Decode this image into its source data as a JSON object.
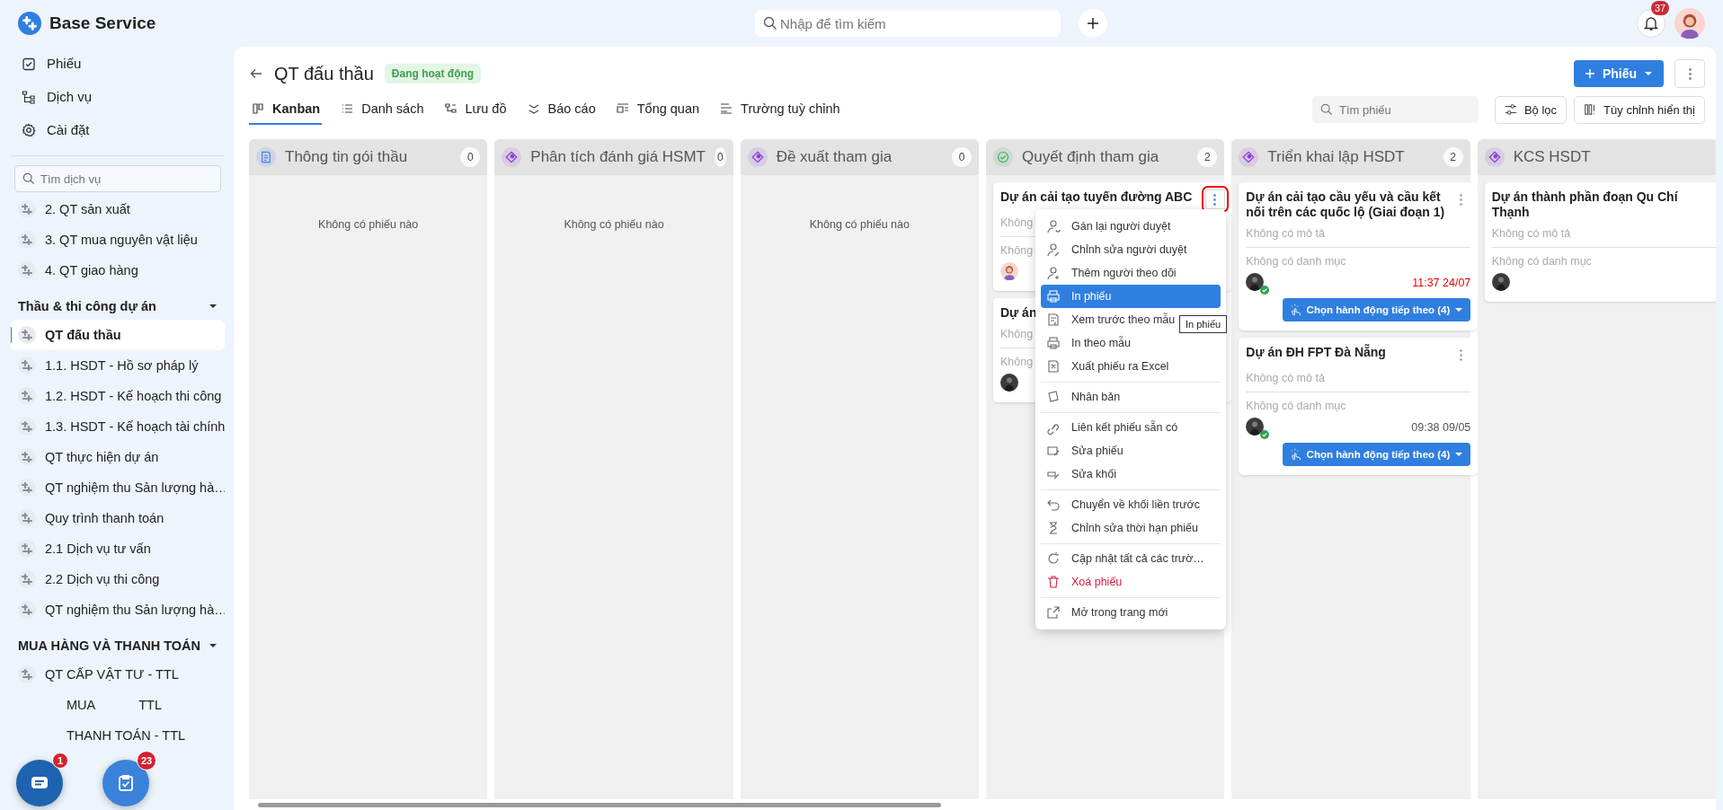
{
  "app": {
    "name": "Base Service"
  },
  "topbar": {
    "search_placeholder": "Nhập để tìm kiếm",
    "notification_badge": "37"
  },
  "sidebar": {
    "nav": [
      {
        "label": "Phiếu"
      },
      {
        "label": "Dịch vụ"
      },
      {
        "label": "Cài đặt"
      }
    ],
    "search_placeholder": "Tìm dịch vụ",
    "items": [
      {
        "label": "2. QT sản xuất",
        "selected": false
      },
      {
        "label": "3. QT mua nguyên vật liệu",
        "selected": false
      },
      {
        "label": "4. QT giao hàng",
        "selected": false
      }
    ],
    "groups": [
      {
        "title": "Thầu & thi công dự án",
        "expanded": true,
        "items": [
          {
            "label": "QT đấu thầu",
            "selected": true
          },
          {
            "label": "1.1. HSDT - Hồ sơ pháp lý",
            "selected": false
          },
          {
            "label": "1.2. HSDT - Kế hoạch thi công",
            "selected": false
          },
          {
            "label": "1.3. HSDT - Kế hoạch tài chính",
            "selected": false
          },
          {
            "label": "QT thực hiện dự án",
            "selected": false
          },
          {
            "label": "QT nghiệm thu Sản lượng hà…",
            "selected": false
          },
          {
            "label": "Quy trình thanh toán",
            "selected": false
          },
          {
            "label": "2.1 Dịch vụ tư vấn",
            "selected": false
          },
          {
            "label": "2.2 Dịch vụ thi công",
            "selected": false
          },
          {
            "label": "QT nghiệm thu Sản lượng hà…",
            "selected": false
          }
        ]
      },
      {
        "title": "MUA HÀNG VÀ THANH TOÁN",
        "expanded": true,
        "items": [
          {
            "label": "QT CẤP VẬT TƯ - TTL",
            "selected": false
          },
          {
            "parts": [
              "MUA",
              "TTL"
            ],
            "selected": false
          },
          {
            "parts": [
              "THANH TOÁN - TTL"
            ],
            "selected": false
          }
        ]
      }
    ]
  },
  "floating_buttons": [
    {
      "kind": "chat",
      "badge": "1"
    },
    {
      "kind": "tasks",
      "badge": "23"
    }
  ],
  "page": {
    "title": "QT đấu thầu",
    "status": "Đang hoạt động",
    "new_button": "Phiếu"
  },
  "tabs": [
    {
      "label": "Kanban",
      "selected": true
    },
    {
      "label": "Danh sách",
      "selected": false
    },
    {
      "label": "Lưu đồ",
      "selected": false
    },
    {
      "label": "Báo cáo",
      "selected": false
    },
    {
      "label": "Tổng quan",
      "selected": false
    },
    {
      "label": "Trường tuỳ chỉnh",
      "selected": false
    }
  ],
  "toolbar": {
    "search_placeholder": "Tìm phiếu",
    "filter": "Bộ lọc",
    "customize": "Tùy chỉnh hiển thị"
  },
  "columns": [
    {
      "title": "Thông tin gói thầu",
      "count": "0",
      "kind": "doc",
      "color": "#4a80e8",
      "empty": "Không có phiếu nào"
    },
    {
      "title": "Phân tích đánh giá HSMT",
      "count": "0",
      "kind": "diamond",
      "color": "#8e3fd6",
      "empty": "Không có phiếu nào"
    },
    {
      "title": "Đề xuất tham gia",
      "count": "0",
      "kind": "diamond",
      "color": "#8e3fd6",
      "empty": "Không có phiếu nào"
    },
    {
      "title": "Quyết định tham gia",
      "count": "2",
      "kind": "check",
      "color": "#3fae5a",
      "cards": [
        {
          "title": "Dự án cải tạo tuyến đường ABC",
          "description": "Không",
          "category": "Không",
          "avatar": {
            "kind": "woman"
          },
          "approved": false,
          "menu_open": true
        },
        {
          "title": "Dự án",
          "description": "Không",
          "category": "Không",
          "avatar": {
            "kind": "dark"
          },
          "approved": false
        }
      ]
    },
    {
      "title": "Triển khai lập HSDT",
      "count": "2",
      "kind": "diamond",
      "color": "#8e3fd6",
      "cards": [
        {
          "title": "Dự án cải tạo cầu yếu và cầu kết nối trên các quốc lộ (Giai đoạn 1)",
          "description": "Không có mô tả",
          "category": "Không có danh mục",
          "avatar": {
            "kind": "dark"
          },
          "approved": true,
          "time": "11:37 24/07",
          "overdue": true,
          "action": "Chọn hành động tiếp theo (4)",
          "menu_open": false
        },
        {
          "title": "Dự án ĐH FPT Đà Nẵng",
          "description": "Không có mô tả",
          "category": "Không có danh mục",
          "avatar": {
            "kind": "dark"
          },
          "approved": true,
          "time": "09:38 09/05",
          "overdue": false,
          "action": "Chọn hành động tiếp theo (4)",
          "menu_open": false
        }
      ]
    },
    {
      "title": "KCS HSDT",
      "kind": "diamond",
      "color": "#8e3fd6",
      "cards": [
        {
          "title": "Dự án thành phần đoạn Qu Chí Thạnh",
          "description": "Không có mô tả",
          "category": "Không có danh mục",
          "avatar": {
            "kind": "dark"
          },
          "approved": false
        }
      ]
    }
  ],
  "context_menu": {
    "tooltip": "In phiếu",
    "items": [
      {
        "label": "Gán lại người duyệt",
        "selected": false
      },
      {
        "label": "Chỉnh sửa người duyệt",
        "selected": false
      },
      {
        "label": "Thêm người theo dõi",
        "selected": false
      },
      {
        "label": "In phiếu",
        "selected": true
      },
      {
        "label": "Xem trước theo mẫu",
        "selected": false
      },
      {
        "label": "In theo mẫu",
        "selected": false
      },
      {
        "label": "Xuất phiếu ra Excel",
        "selected": false
      },
      {
        "label": "Nhân bản",
        "selected": false,
        "divider_before": true
      },
      {
        "label": "Liên kết phiếu sẵn có",
        "selected": false,
        "divider_before": true
      },
      {
        "label": "Sửa phiếu",
        "selected": false
      },
      {
        "label": "Sửa khối",
        "selected": false
      },
      {
        "label": "Chuyển về khối liền trước",
        "selected": false,
        "divider_before": true
      },
      {
        "label": "Chỉnh sửa thời hạn phiếu",
        "selected": false
      },
      {
        "label": "Cập nhật tất cả các trườ…",
        "selected": false,
        "divider_before": true
      },
      {
        "label": "Xoá phiếu",
        "selected": false,
        "danger": true
      },
      {
        "label": "Mở trong trang mới",
        "selected": false,
        "divider_before": true
      }
    ]
  }
}
